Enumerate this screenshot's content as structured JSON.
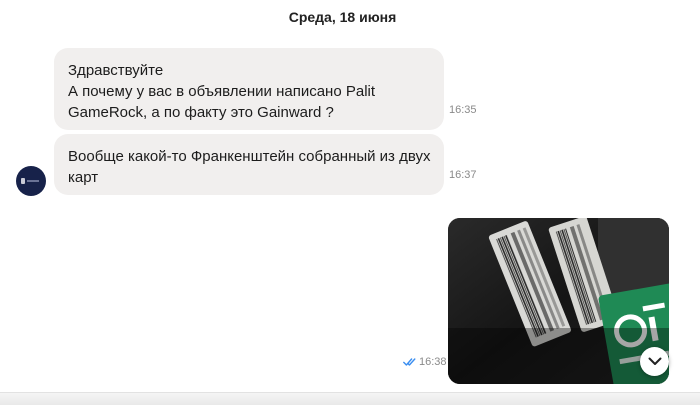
{
  "chat": {
    "date_separator": "Среда, 18 июня",
    "messages": [
      {
        "direction": "incoming",
        "lines": [
          "Здравствуйте",
          "А почему у вас в объявлении написано Palit",
          "GameRock, а по факту это Gainward ?"
        ],
        "time": "16:35"
      },
      {
        "direction": "incoming",
        "lines": [
          "Вообще какой-то Франкенштейн собранный из двух",
          "карт"
        ],
        "time": "16:37"
      },
      {
        "direction": "outgoing",
        "type": "photo",
        "time": "16:38",
        "read_status": "read"
      }
    ]
  },
  "icons": {
    "read_checks": "double-check-icon",
    "scroll_down": "chevron-down-icon"
  },
  "colors": {
    "incoming_bubble": "#f1efee",
    "read_checks": "#3b8ef0",
    "time_text": "#8a8a8a",
    "avatar_bg": "#17224a"
  }
}
